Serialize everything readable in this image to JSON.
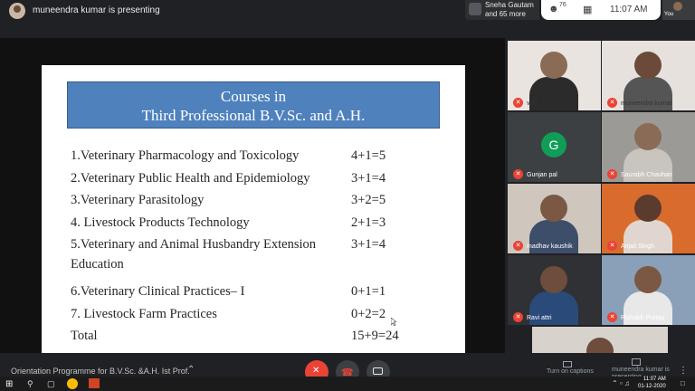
{
  "header": {
    "presenting_text": "muneendra kumar is presenting",
    "participants_line1": "Sneha Gautam",
    "participants_line2": "and 65 more",
    "people_badge": "76",
    "time": "11:07 AM",
    "self_label": "You"
  },
  "slide": {
    "title_line1": "Courses in",
    "title_line2": "Third Professional B.V.Sc. and A.H.",
    "rows": [
      {
        "label": "1.Veterinary Pharmacology and Toxicology",
        "value": "4+1=5"
      },
      {
        "label": "2.Veterinary Public Health and Epidemiology",
        "value": "3+1=4"
      },
      {
        "label": "3.Veterinary Parasitology",
        "value": "3+2=5"
      },
      {
        "label": "4. Livestock Products Technology",
        "value": "2+1=3"
      },
      {
        "label": "5.Veterinary and Animal Husbandry Extension",
        "label2": "Education",
        "value": "3+1=4"
      },
      {
        "label": "6.Veterinary Clinical Practices– I",
        "value": "0+1=1"
      },
      {
        "label": "7. Livestock Farm Practices",
        "value": "0+2=2"
      },
      {
        "label": "Total",
        "value": "15+9=24"
      }
    ]
  },
  "participants": [
    {
      "name": "vod",
      "kind": "video"
    },
    {
      "name": "muneendra kumar",
      "kind": "video"
    },
    {
      "name": "Gunjan pal",
      "kind": "avatar",
      "initial": "G"
    },
    {
      "name": "Saurabh Chauhan",
      "kind": "video"
    },
    {
      "name": "madhav kaushik",
      "kind": "video"
    },
    {
      "name": "Anjali Singh",
      "kind": "video"
    },
    {
      "name": "Ravi attri",
      "kind": "video"
    },
    {
      "name": "Rishabh Pratap",
      "kind": "video"
    }
  ],
  "bottom": {
    "meeting_title": "Orientation Programme for B.V.Sc. &A.H. Ist Prof.",
    "captions_label": "Turn on captions",
    "present_label": "muneendra kumar is presenting",
    "clock_time": "11:07 AM",
    "clock_date": "01-12-2020"
  },
  "colors": {
    "title_box": "#4f81bd",
    "meet_bg": "#202124",
    "mute_red": "#ea4335",
    "avatar_green": "#0f9d58"
  }
}
